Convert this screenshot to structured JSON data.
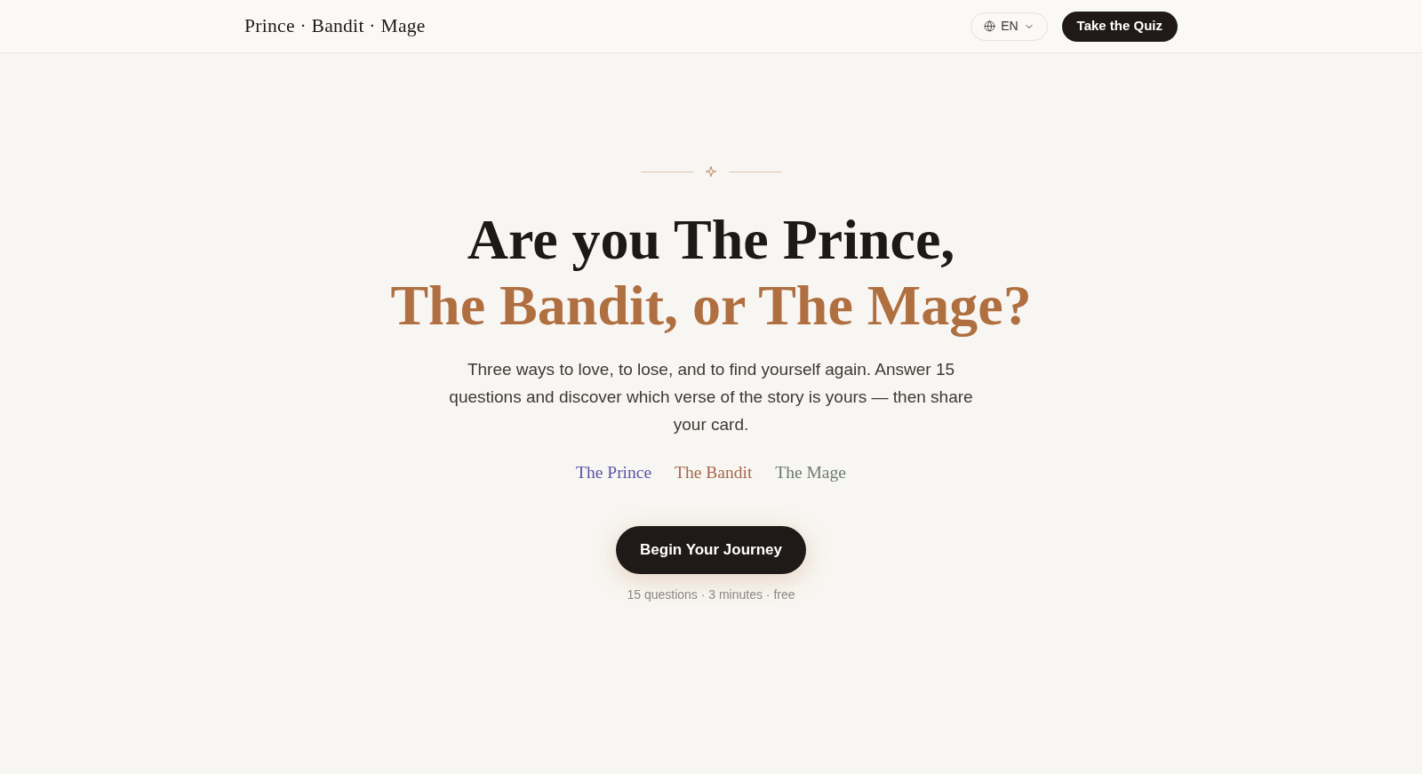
{
  "header": {
    "logo": "Prince · Bandit · Mage",
    "language": {
      "label": "EN"
    },
    "cta": "Take the Quiz"
  },
  "hero": {
    "heading_lines": [
      {
        "text": "Are you The Prince,",
        "kind": "plain"
      },
      {
        "text": "The Bandit, or The Mage?",
        "kind": "accent"
      }
    ],
    "intro": "Three ways to love, to lose, and to find yourself again. Answer 15 questions and discover which verse of the story is yours — then share your card.",
    "archetypes": [
      {
        "label": "The Prince",
        "color": "#5a55a8"
      },
      {
        "label": "The Bandit",
        "color": "#a8674a"
      },
      {
        "label": "The Mage",
        "color": "#6c7b6e"
      }
    ],
    "button": "Begin Your Journey",
    "meta": "15 questions · 3 minutes · free"
  }
}
